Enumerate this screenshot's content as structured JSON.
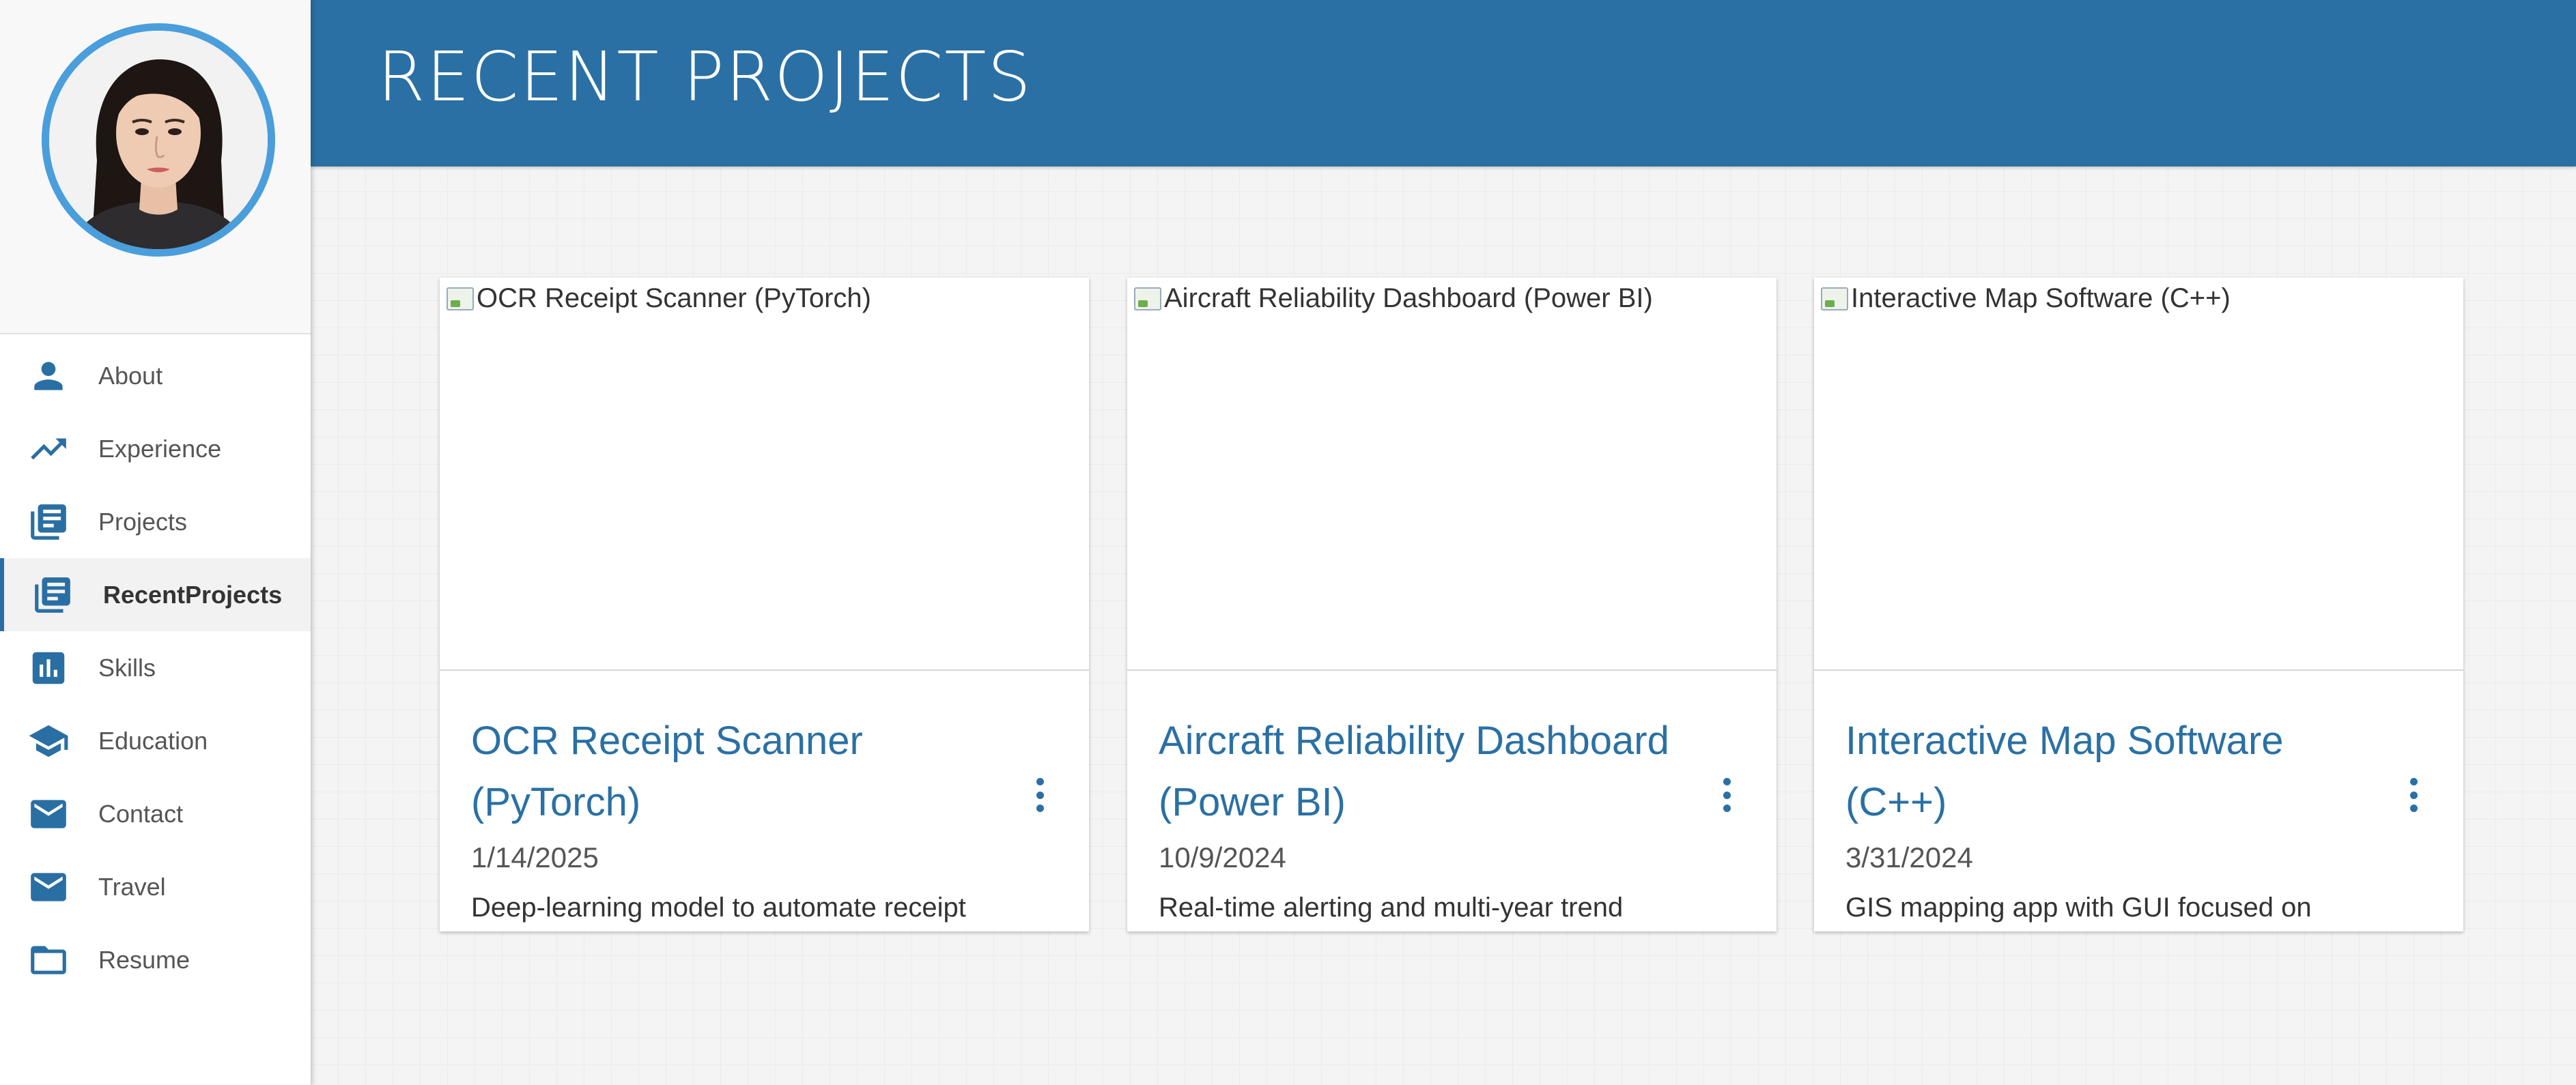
{
  "sidebar": {
    "items": [
      {
        "label": "About",
        "icon": "person-icon"
      },
      {
        "label": "Experience",
        "icon": "trending-up-icon"
      },
      {
        "label": "Projects",
        "icon": "library-books-icon"
      },
      {
        "label": "RecentProjects",
        "icon": "library-books-icon"
      },
      {
        "label": "Skills",
        "icon": "bar-chart-icon"
      },
      {
        "label": "Education",
        "icon": "school-icon"
      },
      {
        "label": "Contact",
        "icon": "mail-icon"
      },
      {
        "label": "Travel",
        "icon": "mail-icon"
      },
      {
        "label": "Resume",
        "icon": "folder-icon"
      }
    ],
    "active_item": "RecentProjects"
  },
  "header": {
    "title": "RECENT PROJECTS"
  },
  "cards": [
    {
      "image_alt": "OCR Receipt Scanner (PyTorch)",
      "title": "OCR Receipt Scanner (PyTorch)",
      "date": "1/14/2025",
      "description": "Deep-learning model to automate receipt parsing and expense tracking."
    },
    {
      "image_alt": "Aircraft Reliability Dashboard (Power BI)",
      "title": "Aircraft Reliability Dashboard (Power BI)",
      "date": "10/9/2024",
      "description": "Real-time alerting and multi-year trend"
    },
    {
      "image_alt": "Interactive Map Software (C++)",
      "title": "Interactive Map Software (C++)",
      "date": "3/31/2024",
      "description": "GIS mapping app with GUI focused on usability and responsiveness."
    }
  ],
  "colors": {
    "accent": "#2a70a4",
    "avatar_ring": "#4a9edb",
    "background": "#f4f4f4"
  }
}
